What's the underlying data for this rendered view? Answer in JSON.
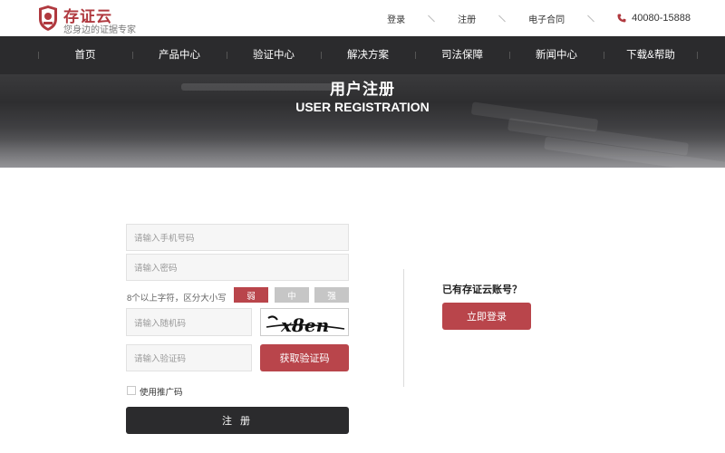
{
  "brand": {
    "name": "存证云",
    "slogan": "您身边的证据专家",
    "logo_text": "存证云",
    "accent": "#b0393f"
  },
  "toplinks": {
    "login": "登录",
    "register": "注册",
    "contract": "电子合同",
    "phone": "40080-15888"
  },
  "nav": [
    "首页",
    "产品中心",
    "验证中心",
    "解决方案",
    "司法保障",
    "新闻中心",
    "下载&帮助"
  ],
  "hero": {
    "title": "用户注册",
    "subtitle": "USER REGISTRATION"
  },
  "form": {
    "phone_placeholder": "请输入手机号码",
    "password_placeholder": "请输入密码",
    "password_hint": "8个以上字符，区分大小写",
    "strength": {
      "weak": "弱",
      "medium": "中",
      "strong": "强",
      "colors": {
        "weak": "#b9454b",
        "inactive": "#c6c6c6"
      }
    },
    "random_code_placeholder": "请输入随机码",
    "captcha_text": "x8en",
    "sms_code_placeholder": "请输入验证码",
    "get_code_button": "获取验证码",
    "referral_label": "使用推广码",
    "submit_button": "注 册"
  },
  "side": {
    "have_account": "已有存证云账号？",
    "login_button": "立即登录"
  }
}
